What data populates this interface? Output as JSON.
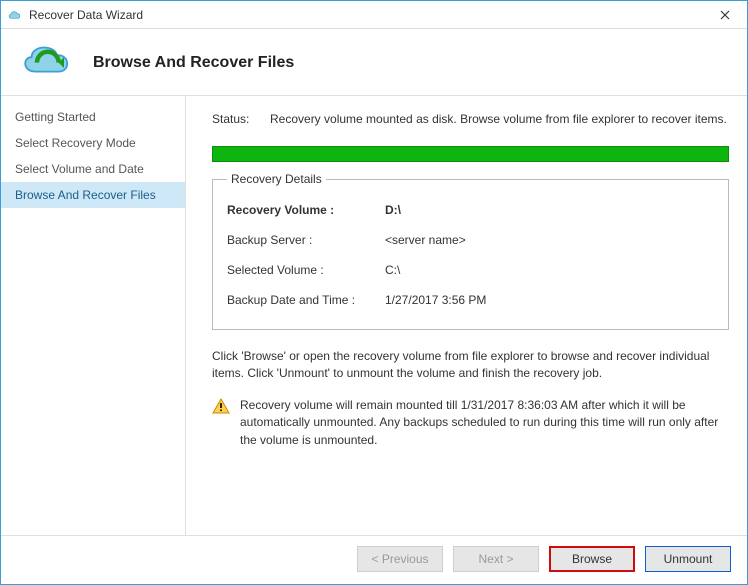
{
  "window": {
    "title": "Recover Data Wizard"
  },
  "header": {
    "title": "Browse And Recover Files"
  },
  "sidebar": {
    "items": [
      {
        "label": "Getting Started"
      },
      {
        "label": "Select Recovery Mode"
      },
      {
        "label": "Select Volume and Date"
      },
      {
        "label": "Browse And Recover Files"
      }
    ]
  },
  "main": {
    "status_label": "Status:",
    "status_text": "Recovery volume mounted as disk. Browse volume from file explorer to recover items.",
    "details_legend": "Recovery Details",
    "rows": {
      "recovery_volume_k": "Recovery Volume  :",
      "recovery_volume_v": "D:\\",
      "backup_server_k": "Backup Server :",
      "backup_server_v": "<server name>",
      "selected_volume_k": "Selected Volume :",
      "selected_volume_v": "C:\\",
      "backup_dt_k": "Backup Date and Time :",
      "backup_dt_v": "1/27/2017 3:56 PM"
    },
    "hint": "Click 'Browse' or open the recovery volume from file explorer to browse and recover individual items. Click 'Unmount' to unmount the volume and finish the recovery job.",
    "warning": "Recovery volume will remain mounted till 1/31/2017 8:36:03 AM after which it will be automatically unmounted. Any backups scheduled to run during this time will run only after the volume is unmounted."
  },
  "footer": {
    "previous": "< Previous",
    "next": "Next >",
    "browse": "Browse",
    "unmount": "Unmount"
  }
}
